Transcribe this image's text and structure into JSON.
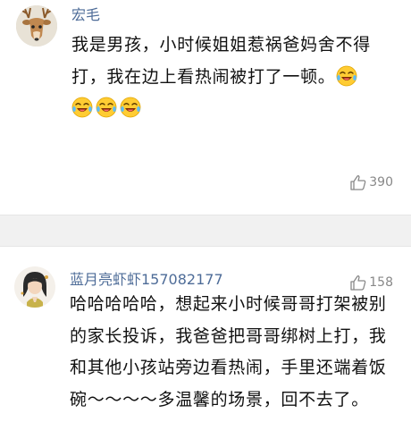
{
  "comments": [
    {
      "username": "宏毛",
      "text_line1": "我是男孩，小时候姐姐惹祸爸妈舍不得",
      "text_line2": "打，我在边上看热闹被打了一顿。",
      "emoji_icons": [
        "laugh-cry-emoji",
        "laugh-cry-emoji",
        "laugh-cry-emoji",
        "laugh-cry-emoji"
      ],
      "likes": "390"
    },
    {
      "username": "蓝月亮虾虾157082177",
      "text": "哈哈哈哈哈，想起来小时候哥哥打架被别的家长投诉，我爸爸把哥哥绑树上打，我和其他小孩站旁边看热闹，手里还端着饭碗～～～～多温馨的场景，回不去了。",
      "likes": "158"
    }
  ],
  "colors": {
    "username": "#4e6c98",
    "text": "#111111",
    "likes": "#888888",
    "separator": "#f1f1f1",
    "emoji_face": "#ffcc33"
  }
}
